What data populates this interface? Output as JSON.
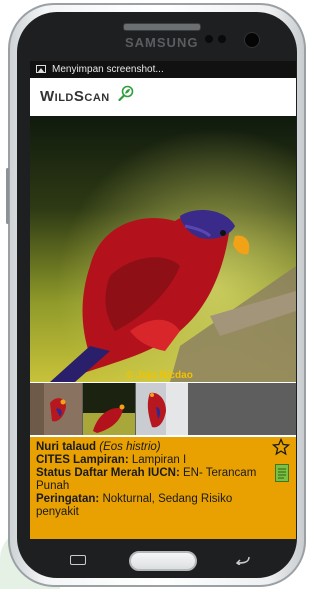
{
  "device": {
    "brand": "SAMSUNG"
  },
  "status_bar": {
    "notification_text": "Menyimpan screenshot...",
    "icon": "image-icon"
  },
  "app": {
    "logo_text": "WildScan",
    "logo_icon": "magnifier-leaf-icon"
  },
  "photo": {
    "credit": "© Jojo Nicdao"
  },
  "thumbnails": {
    "count": 3
  },
  "species": {
    "common_name": "Nuri talaud",
    "scientific_name": "(Eos histrio)",
    "cites_label": "CITES Lampiran:",
    "cites_value": "Lampiran I",
    "iucn_label": "Status Daftar Merah IUCN:",
    "iucn_value": "EN- Terancam Punah",
    "warning_label": "Peringatan:",
    "warning_value": "Nokturnal, Sedang Risiko penyakit"
  },
  "colors": {
    "info_bg": "#e8a101",
    "credit": "#f2c200",
    "accent_green": "#2e9e3a"
  }
}
